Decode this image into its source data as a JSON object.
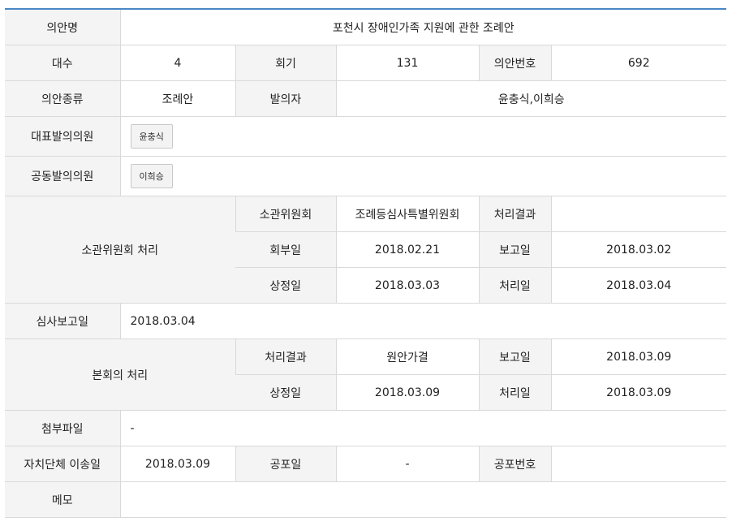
{
  "labels": {
    "title": "의안명",
    "daesu": "대수",
    "hoegi": "회기",
    "bill_no": "의안번호",
    "kind": "의안종류",
    "proposer": "발의자",
    "lead_member": "대표발의의원",
    "co_member": "공동발의의원",
    "committee_proc": "소관위원회 처리",
    "committee": "소관위원회",
    "result": "처리결과",
    "referral_date": "회부일",
    "report_date": "보고일",
    "submit_date": "상정일",
    "proc_date": "처리일",
    "review_report_date": "심사보고일",
    "plenary_proc": "본회의 처리",
    "attachment": "첨부파일",
    "transfer_date": "자치단체 이송일",
    "promulgation_date": "공포일",
    "promulgation_no": "공포번호",
    "memo": "메모"
  },
  "values": {
    "title": "포천시 장애인가족 지원에 관한 조례안",
    "daesu": "4",
    "hoegi": "131",
    "bill_no": "692",
    "kind": "조례안",
    "proposer": "윤충식,이희승",
    "lead_member_btn": "윤충식",
    "co_member_btn": "이희승",
    "committee": "조례등심사특별위원회",
    "committee_result": "",
    "referral_date": "2018.02.21",
    "committee_report_date": "2018.03.02",
    "committee_submit_date": "2018.03.03",
    "committee_proc_date": "2018.03.04",
    "review_report_date": "2018.03.04",
    "plenary_result": "원안가결",
    "plenary_report_date": "2018.03.09",
    "plenary_submit_date": "2018.03.09",
    "plenary_proc_date": "2018.03.09",
    "attachment": "-",
    "transfer_date": "2018.03.09",
    "promulgation_date": "-",
    "promulgation_no": "",
    "memo": ""
  }
}
